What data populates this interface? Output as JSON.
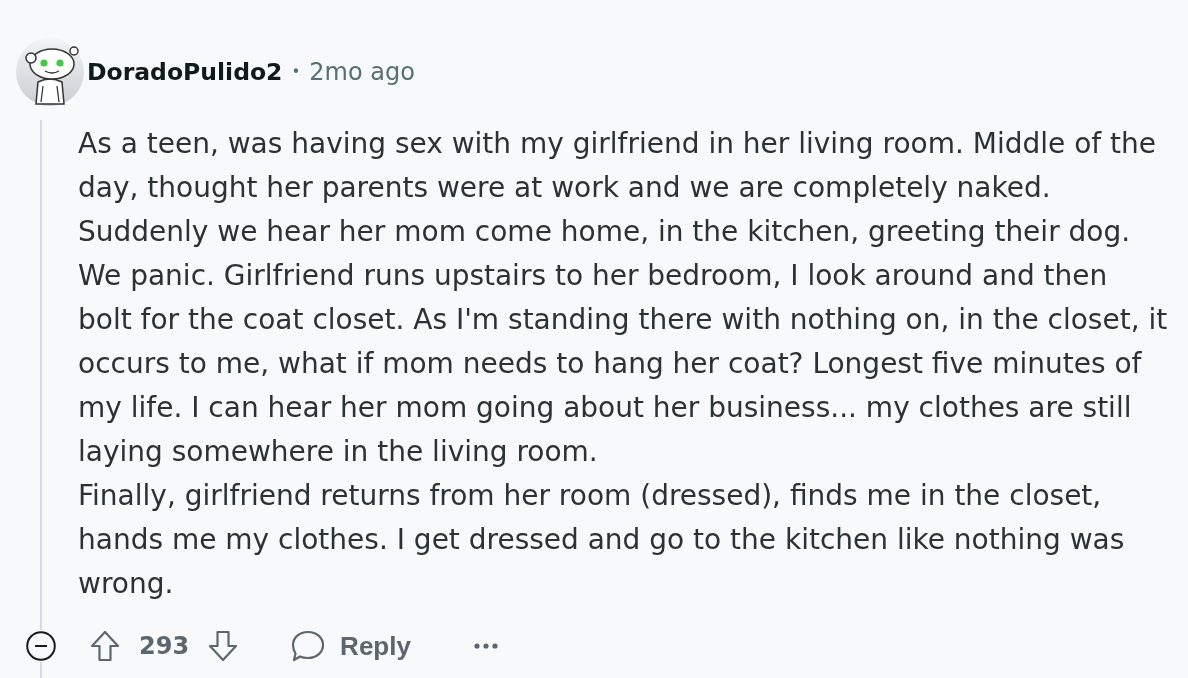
{
  "comment": {
    "author": "DoradoPulido2",
    "separator": "•",
    "time": "2mo ago",
    "expanded": true,
    "paragraphs": [
      "As a teen, was having sex with my girlfriend in her living room. Middle of the day, thought her parents were at work and we are completely naked. Suddenly we hear her mom come home, in the kitchen, greeting their dog. We panic. Girlfriend runs upstairs to her bedroom, I look around and then bolt for the coat closet. As I'm standing there with nothing on, in the closet, it occurs to me, what if mom needs to hang her coat? Longest five minutes of my life. I can hear her mom going about her business... my clothes are still laying somewhere in the living room.",
      "Finally, girlfriend returns from her room (dressed), finds me in the closet, hands me my clothes. I get dressed and go to the kitchen like nothing was wrong."
    ],
    "score": "293",
    "reply_label": "Reply"
  }
}
